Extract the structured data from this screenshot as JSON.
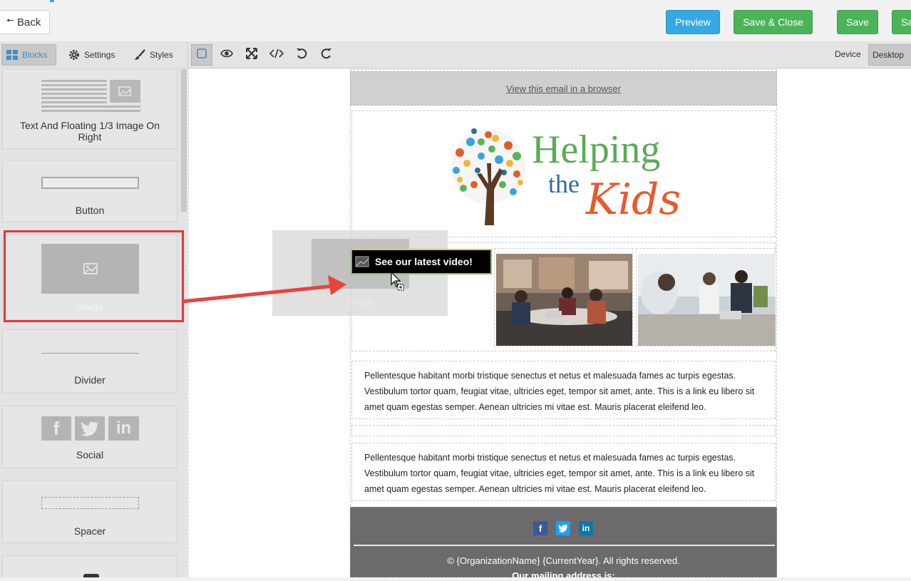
{
  "header": {
    "back_label": "Back",
    "preview_label": "Preview",
    "save_close_label": "Save & Close",
    "save_label": "Save",
    "save_partial_label": "Sa"
  },
  "toolbar": {
    "tabs": [
      {
        "label": "Blocks",
        "icon": "grid-icon"
      },
      {
        "label": "Settings",
        "icon": "gear-icon"
      },
      {
        "label": "Styles",
        "icon": "brush-icon"
      }
    ],
    "tools": [
      "select-icon",
      "eye-icon",
      "fullscreen-icon",
      "code-icon",
      "undo-icon",
      "redo-icon"
    ],
    "device_label": "Device",
    "device_value": "Desktop"
  },
  "sidebar": {
    "blocks": [
      {
        "label": "Text And Floating 1/3 Image On Right"
      },
      {
        "label": "Button"
      },
      {
        "label": "Image"
      },
      {
        "label": "Divider"
      },
      {
        "label": "Social"
      },
      {
        "label": "Spacer"
      }
    ]
  },
  "email": {
    "view_in_browser": "View this email in a browser",
    "logo": {
      "line1": "Helping",
      "line2a": "the",
      "line2b": "Kids"
    },
    "video_label": "See our latest video!",
    "drag_ghost_label": "Image",
    "text_block_1": "Pellentesque habitant morbi tristique senectus et netus et malesuada fames ac turpis egestas. Vestibulum tortor quam, feugiat vitae, ultricies eget, tempor sit amet, ante. This is a link eu libero sit amet quam egestas semper. Aenean ultricies mi vitae est. Mauris placerat eleifend leo.",
    "text_block_2": "Pellentesque habitant morbi tristique senectus et netus et malesuada fames ac turpis egestas. Vestibulum tortor quam, feugiat vitae, ultricies eget, tempor sit amet, ante. This is a link eu libero sit amet quam egestas semper. Aenean ultricies mi vitae est. Mauris placerat eleifend leo.",
    "footer_copyright": "© {OrganizationName} {CurrentYear}. All rights reserved.",
    "footer_address_label": "Our mailing address is:"
  },
  "colors": {
    "preview": "#35a9e1",
    "save": "#4bb358",
    "highlight": "#e0393e",
    "facebook": "#3b5998",
    "twitter": "#1da1f2",
    "linkedin": "#0e76a8"
  }
}
